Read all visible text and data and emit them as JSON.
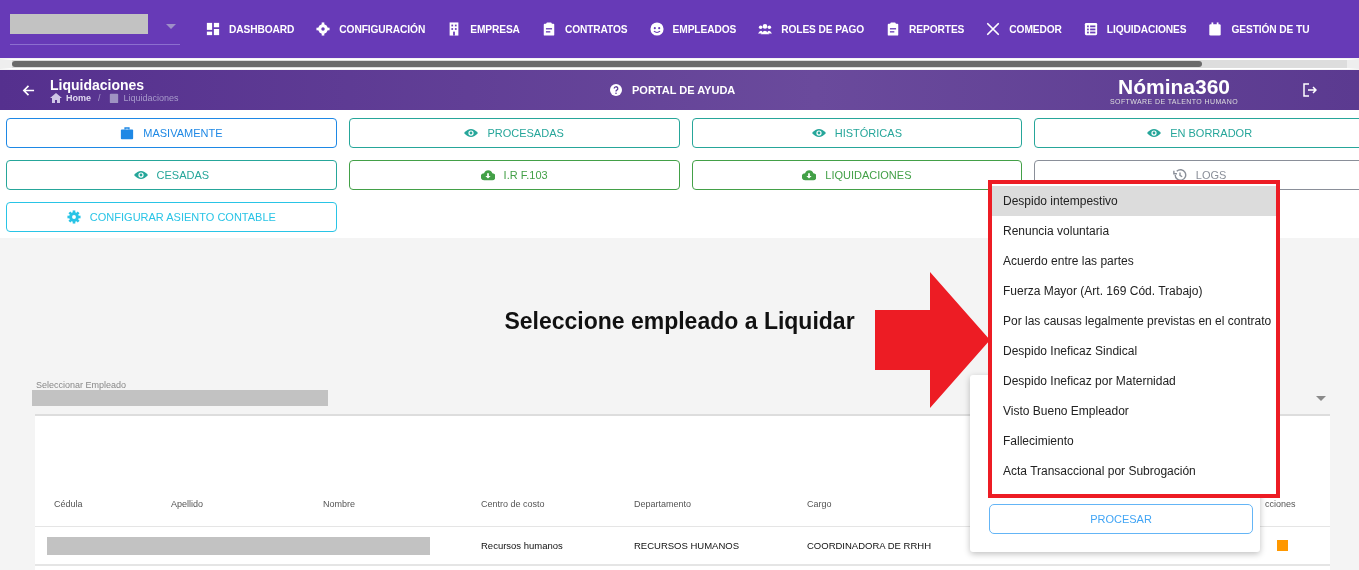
{
  "nav": {
    "items": [
      "DASHBOARD",
      "CONFIGURACIÓN",
      "EMPRESA",
      "CONTRATOS",
      "EMPLEADOS",
      "ROLES DE PAGO",
      "REPORTES",
      "COMEDOR",
      "LIQUIDACIONES",
      "GESTIÓN DE TU"
    ]
  },
  "header": {
    "title": "Liquidaciones",
    "breadcrumb": [
      "Home",
      "Liquidaciones"
    ],
    "breadcrumb_separator": "/",
    "help": "PORTAL DE AYUDA",
    "logo": "Nómina360",
    "tagline": "SOFTWARE DE TALENTO HUMANO"
  },
  "actions": [
    {
      "label": "MASIVAMENTE",
      "kind": "mass",
      "color": "#1e88e5"
    },
    {
      "label": "PROCESADAS",
      "kind": "view",
      "color": "#26a69a"
    },
    {
      "label": "HISTÓRICAS",
      "kind": "view",
      "color": "#26a69a"
    },
    {
      "label": "EN BORRADOR",
      "kind": "view",
      "color": "#26a69a"
    },
    {
      "label": "CESADAS",
      "kind": "view",
      "color": "#26a69a"
    },
    {
      "label": "I.R F.103",
      "kind": "download",
      "color": "#43a047"
    },
    {
      "label": "LIQUIDACIONES",
      "kind": "download",
      "color": "#43a047"
    },
    {
      "label": "LOGS",
      "kind": "log",
      "color": "#8a8f99"
    },
    {
      "label": "CONFIGURAR ASIENTO CONTABLE",
      "kind": "config",
      "color": "#29c4e6"
    }
  ],
  "heading": "Seleccione empleado a Liquidar",
  "employee_select": {
    "label": "Seleccionar Empleado"
  },
  "table": {
    "columns": [
      "Cédula",
      "Apellido",
      "Nombre",
      "Centro de costo",
      "Departamento",
      "Cargo",
      "cciones"
    ],
    "rows": [
      {
        "Centro de costo": "Recursos humanos",
        "Departamento": "RECURSOS HUMANOS",
        "Cargo": "COORDINADORA DE RRHH"
      }
    ]
  },
  "reason_menu": {
    "items": [
      {
        "label": "Despido intempestivo",
        "selected": true
      },
      {
        "label": "Renuncia voluntaria",
        "selected": false
      },
      {
        "label": "Acuerdo entre las partes",
        "selected": false
      },
      {
        "label": "Fuerza Mayor (Art. 169 Cód. Trabajo)",
        "selected": false
      },
      {
        "label": "Por las causas legalmente previstas en el contrato",
        "selected": false
      },
      {
        "label": "Despido Ineficaz Sindical",
        "selected": false
      },
      {
        "label": "Despido Ineficaz por Maternidad",
        "selected": false
      },
      {
        "label": "Visto Bueno Empleador",
        "selected": false
      },
      {
        "label": "Fallecimiento",
        "selected": false
      },
      {
        "label": "Acta Transaccional por Subrogación",
        "selected": false
      }
    ],
    "button": "PROCESAR"
  }
}
